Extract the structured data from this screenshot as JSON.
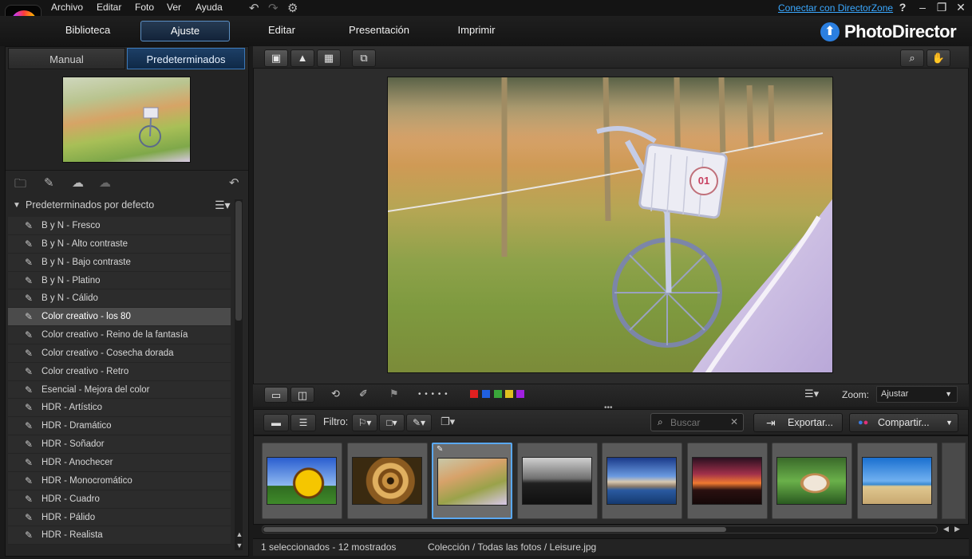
{
  "menu": {
    "items": [
      "Archivo",
      "Editar",
      "Foto",
      "Ver",
      "Ayuda"
    ],
    "connect_link": "Conectar con DirectorZone",
    "help": "?",
    "minimize": "–",
    "restore": "❐",
    "close": "✕"
  },
  "modes": {
    "library": "Biblioteca",
    "adjust": "Ajuste",
    "edit": "Editar",
    "slideshow": "Presentación",
    "print": "Imprimir",
    "active": "Ajuste"
  },
  "brand": {
    "name": "PhotoDirector",
    "badge_glyph": "⬆"
  },
  "left_panel": {
    "tabs": {
      "manual": "Manual",
      "presets": "Predeterminados",
      "active": "Predeterminados"
    },
    "preset_group": "Predeterminados por defecto",
    "presets": [
      "B y N - Fresco",
      "B y N - Alto contraste",
      "B y N - Bajo contraste",
      "B y N - Platino",
      "B y N - Cálido",
      "Color creativo - los 80",
      "Color creativo - Reino de la fantasía",
      "Color creativo - Cosecha dorada",
      "Color creativo - Retro",
      "Esencial - Mejora del color",
      "HDR - Artístico",
      "HDR - Dramático",
      "HDR - Soñador",
      "HDR - Anochecer",
      "HDR - Monocromático",
      "HDR - Cuadro",
      "HDR - Pálido",
      "HDR - Realista"
    ],
    "selected_preset": "Color creativo - los 80"
  },
  "viewer": {
    "view_icons": [
      "single-view-icon",
      "photo-view-icon",
      "grid-view-icon",
      "compare-view-icon"
    ],
    "zoom_label": "Zoom:",
    "zoom_value": "Ajustar",
    "color_labels": [
      "#e02020",
      "#2060e0",
      "#3aa83a",
      "#e0c020",
      "#a020e0"
    ],
    "rating_dots": "• • • • •"
  },
  "filmstrip": {
    "filter_label": "Filtro:",
    "search_placeholder": "Buscar",
    "export_label": "Exportar...",
    "share_label": "Compartir...",
    "thumbnails": [
      "sunflower",
      "spiral-shell",
      "bicycle",
      "dark-landscape",
      "coast-town",
      "sunset-clouds",
      "cat-in-grass",
      "beach-couple"
    ],
    "selected_thumbnail": "bicycle"
  },
  "status": {
    "selection": "1 seleccionados - 12 mostrados",
    "path": "Colección / Todas las fotos / Leisure.jpg"
  }
}
